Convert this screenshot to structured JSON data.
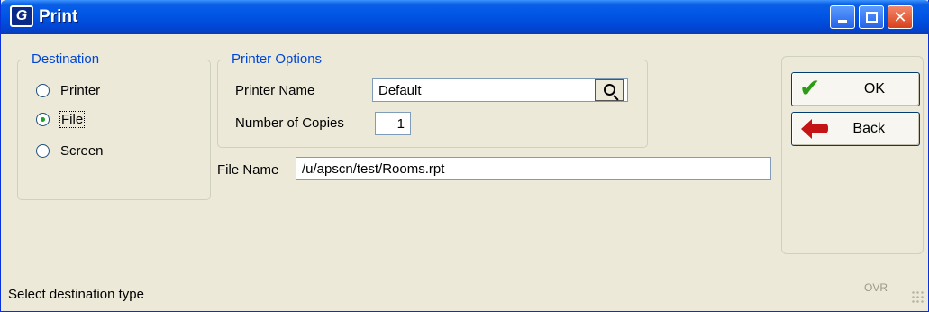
{
  "window": {
    "title": "Print",
    "app_icon_glyph": "G",
    "minimize_label": "",
    "maximize_label": "",
    "close_label": "✕"
  },
  "destination": {
    "legend": "Destination",
    "options": [
      {
        "label": "Printer",
        "selected": false
      },
      {
        "label": "File",
        "selected": true
      },
      {
        "label": "Screen",
        "selected": false
      }
    ]
  },
  "printer_options": {
    "legend": "Printer Options",
    "printer_name_label": "Printer Name",
    "printer_name_value": "Default",
    "copies_label": "Number of Copies",
    "copies_value": "1"
  },
  "file": {
    "label": "File Name",
    "value": "/u/apscn/test/Rooms.rpt"
  },
  "buttons": {
    "ok_label": "OK",
    "back_label": "Back"
  },
  "status": {
    "message": "Select destination type",
    "ovr": "OVR"
  },
  "colors": {
    "titlebar": "#0055e5",
    "group_legend": "#0046d5",
    "radio_dot": "#21a121",
    "ok_check": "#2d9b16",
    "back_arrow": "#c41414"
  }
}
